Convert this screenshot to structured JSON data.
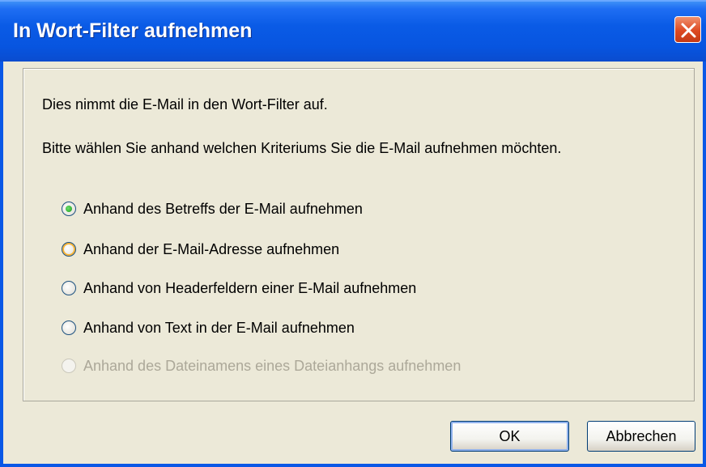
{
  "window": {
    "title": "In Wort-Filter aufnehmen"
  },
  "content": {
    "intro_text": "Dies nimmt die E-Mail in den Wort-Filter auf.",
    "question_text": "Bitte wählen Sie anhand welchen Kriteriums Sie die E-Mail aufnehmen möchten."
  },
  "options": [
    {
      "label": "Anhand des Betreffs der E-Mail aufnehmen",
      "selected": true,
      "enabled": true
    },
    {
      "label": "Anhand der E-Mail-Adresse aufnehmen",
      "selected": false,
      "enabled": true
    },
    {
      "label": "Anhand von Headerfeldern einer E-Mail aufnehmen",
      "selected": false,
      "enabled": true
    },
    {
      "label": "Anhand von Text in der E-Mail aufnehmen",
      "selected": false,
      "enabled": true
    },
    {
      "label": "Anhand des Dateinamens eines Dateianhangs aufnehmen",
      "selected": false,
      "enabled": false
    }
  ],
  "buttons": {
    "ok_label": "OK",
    "cancel_label": "Abbrechen"
  },
  "colors": {
    "titlebar": "#0a5be6",
    "dialog_bg": "#ece9d8",
    "close_button": "#dd4a22",
    "radio_selected": "#1a9a1a",
    "disabled_text": "#aca899"
  }
}
